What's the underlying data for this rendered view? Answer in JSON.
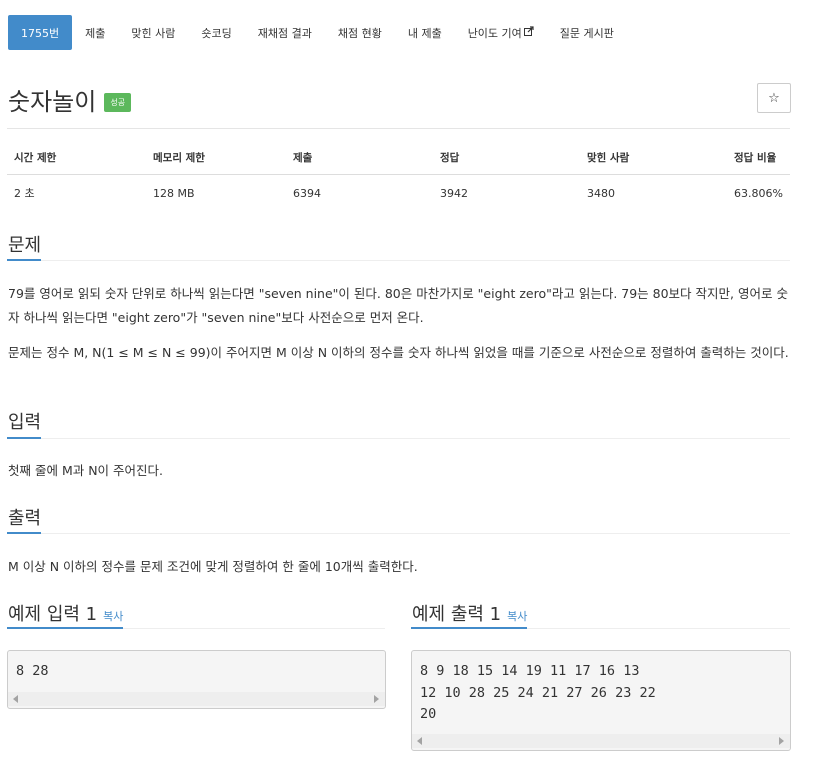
{
  "nav": {
    "items": [
      {
        "label": "1755번",
        "active": true
      },
      {
        "label": "제출"
      },
      {
        "label": "맞힌 사람"
      },
      {
        "label": "숏코딩"
      },
      {
        "label": "재채점 결과"
      },
      {
        "label": "채점 현황"
      },
      {
        "label": "내 제출"
      },
      {
        "label": "난이도 기여",
        "icon": "external-link-icon"
      },
      {
        "label": "질문 게시판"
      }
    ]
  },
  "problem": {
    "title": "숫자놀이",
    "status_badge": "성공",
    "star_icon": "☆"
  },
  "info_table": {
    "headers": [
      "시간 제한",
      "메모리 제한",
      "제출",
      "정답",
      "맞힌 사람",
      "정답 비율"
    ],
    "values": [
      "2 초",
      "128 MB",
      "6394",
      "3942",
      "3480",
      "63.806%"
    ]
  },
  "sections": {
    "description_title": "문제",
    "description_p1": "79를 영어로 읽되 숫자 단위로 하나씩 읽는다면 \"seven nine\"이 된다. 80은 마찬가지로 \"eight zero\"라고 읽는다. 79는 80보다 작지만, 영어로 숫자 하나씩 읽는다면 \"eight zero\"가 \"seven nine\"보다 사전순으로 먼저 온다.",
    "description_p2": "문제는 정수 M, N(1 ≤ M ≤ N ≤ 99)이 주어지면 M 이상 N 이하의 정수를 숫자 하나씩 읽었을 때를 기준으로 사전순으로 정렬하여 출력하는 것이다.",
    "input_title": "입력",
    "input_text": "첫째 줄에 M과 N이 주어진다.",
    "output_title": "출력",
    "output_text": "M 이상 N 이하의 정수를 문제 조건에 맞게 정렬하여 한 줄에 10개씩 출력한다."
  },
  "samples": {
    "input_title": "예제 입력 1",
    "output_title": "예제 출력 1",
    "copy_label": "복사",
    "input_text": "8 28",
    "output_text": "8 9 18 15 14 19 11 17 16 13\n12 10 28 25 24 21 27 26 23 22\n20"
  },
  "colors": {
    "accent": "#428bca",
    "success": "#5cb85c"
  }
}
